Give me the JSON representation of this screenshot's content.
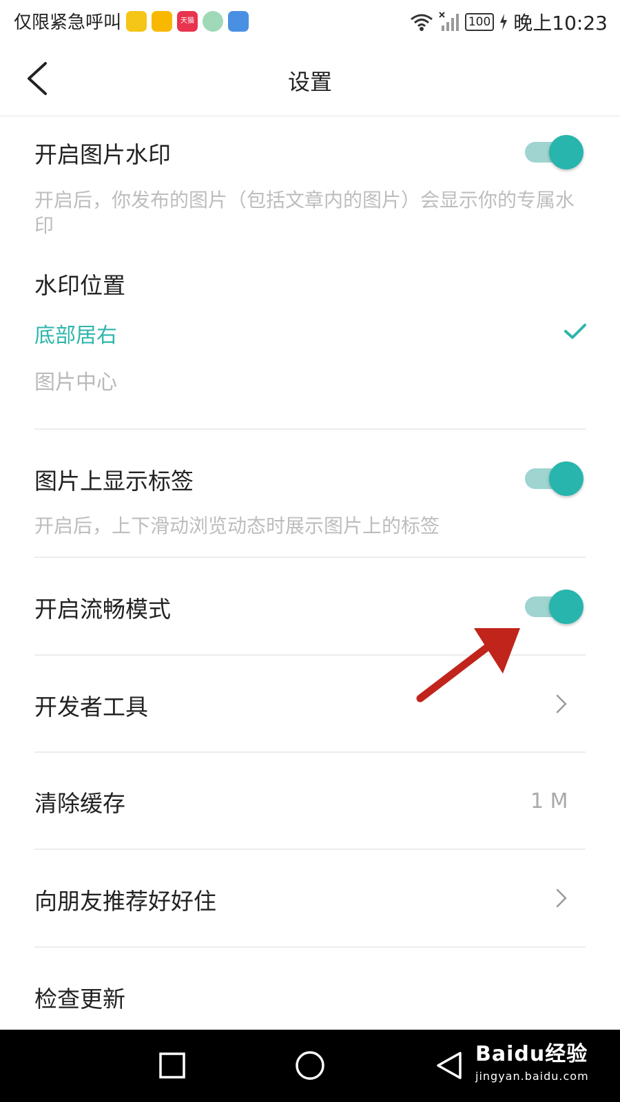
{
  "status_bar": {
    "carrier_text": "仅限紧急呼叫",
    "app_icons": [
      "messenger-icon",
      "taxi-app-icon",
      "tmall-icon",
      "browser-icon",
      "bulb-app-icon"
    ],
    "tmall_label": "天猫",
    "battery_level": "100",
    "time": "晚上10:23"
  },
  "header": {
    "title": "设置"
  },
  "settings": {
    "watermark": {
      "label": "开启图片水印",
      "enabled": true,
      "description": "开启后，你发布的图片（包括文章内的图片）会显示你的专属水印"
    },
    "watermark_position": {
      "label": "水印位置",
      "options": [
        {
          "label": "底部居右",
          "selected": true
        },
        {
          "label": "图片中心",
          "selected": false
        }
      ]
    },
    "show_tags": {
      "label": "图片上显示标签",
      "enabled": true,
      "description": "开启后，上下滑动浏览动态时展示图片上的标签"
    },
    "smooth_mode": {
      "label": "开启流畅模式",
      "enabled": true
    },
    "developer_tools": {
      "label": "开发者工具"
    },
    "clear_cache": {
      "label": "清除缓存",
      "value": "1 M"
    },
    "recommend": {
      "label": "向朋友推荐好好住"
    },
    "check_update": {
      "label": "检查更新"
    }
  },
  "watermark_overlay": {
    "brand": "Baidu经验",
    "url": "jingyan.baidu.com"
  },
  "colors": {
    "accent": "#27b5ad",
    "toggle_track": "#9fd4d0",
    "annotation_arrow": "#c0241b"
  }
}
